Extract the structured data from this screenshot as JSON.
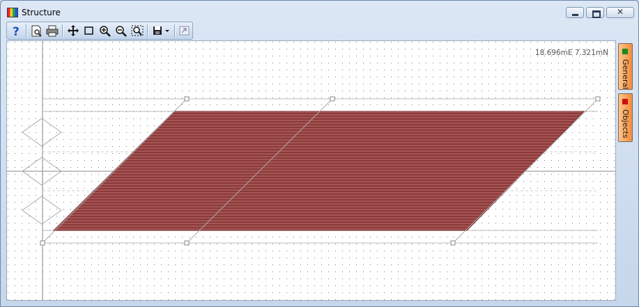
{
  "window": {
    "title": "Structure",
    "close_glyph": "✕"
  },
  "toolbar": {
    "items": [
      "help-icon",
      "print-preview-icon",
      "print-icon",
      "pan-icon",
      "select-rectangle-icon",
      "zoom-in-icon",
      "zoom-out-icon",
      "zoom-extents-icon",
      "save-dropdown-icon",
      "export-icon"
    ]
  },
  "canvas": {
    "coordinate_readout": "18.696mE 7.321mN",
    "shape_fill": "#8b3a3a",
    "hatch_color": "#ffffff"
  },
  "side_panel": {
    "tabs": [
      {
        "label": "General",
        "color": "#1a8a1a"
      },
      {
        "label": "Objects",
        "color": "#cc1010"
      }
    ]
  }
}
